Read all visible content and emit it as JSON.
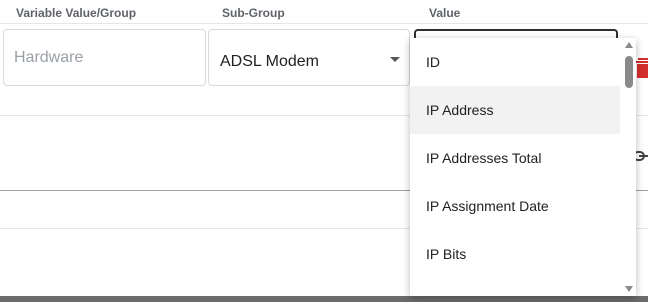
{
  "headers": {
    "variable_value_group": "Variable Value/Group",
    "sub_group": "Sub-Group",
    "value": "Value"
  },
  "row": {
    "variable_placeholder": "Hardware",
    "sub_group_value": "ADSL Modem",
    "value_selected": ""
  },
  "dropdown": {
    "items": [
      "ID",
      "IP Address",
      "IP Addresses Total",
      "IP Assignment Date",
      "IP Bits"
    ],
    "highlighted_item": "IP Address"
  },
  "colors": {
    "delete_icon": "#d32f2f",
    "highlight_bg": "#f2f2f2"
  },
  "icons": {
    "delete": "trash-icon",
    "link": "link-icon",
    "select_caret": "chevron-down-icon"
  }
}
